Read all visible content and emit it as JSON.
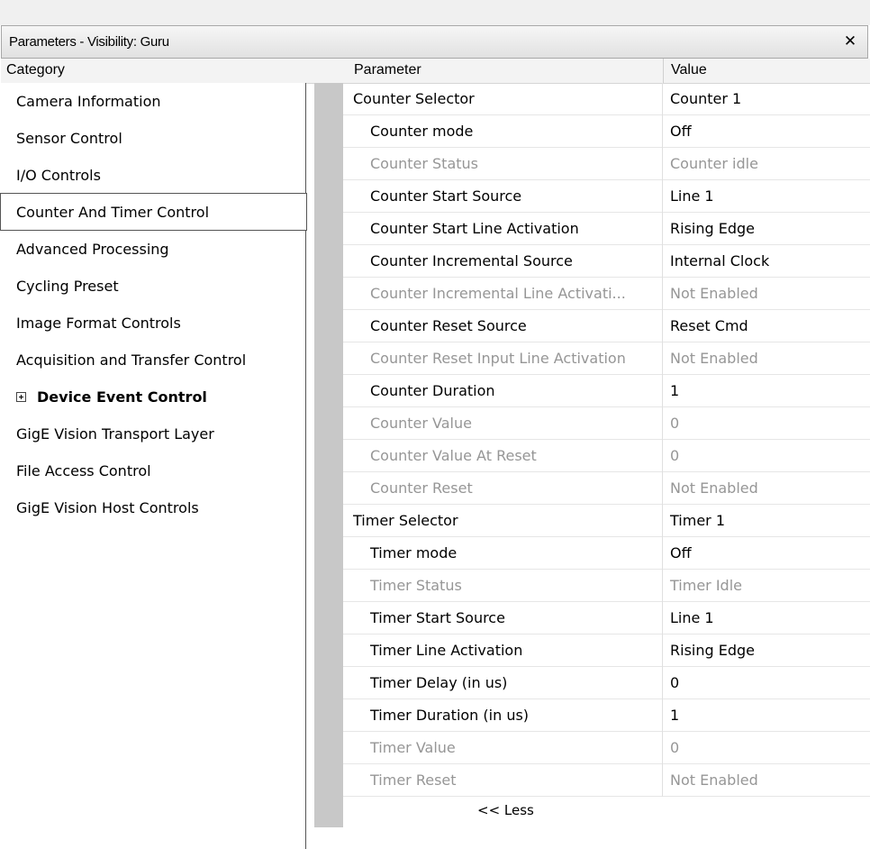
{
  "window": {
    "title": "Parameters - Visibility: Guru",
    "close_glyph": "✕"
  },
  "columns": {
    "category": "Category",
    "parameter": "Parameter",
    "value": "Value"
  },
  "categories": [
    {
      "label": "Camera Information"
    },
    {
      "label": "Sensor Control"
    },
    {
      "label": "I/O Controls"
    },
    {
      "label": "Counter And Timer Control",
      "selected": true
    },
    {
      "label": "Advanced Processing"
    },
    {
      "label": "Cycling Preset"
    },
    {
      "label": "Image Format Controls"
    },
    {
      "label": "Acquisition and Transfer Control"
    },
    {
      "label": "Device Event Control",
      "expandable": true,
      "bold": true
    },
    {
      "label": "GigE Vision Transport Layer"
    },
    {
      "label": "File Access Control"
    },
    {
      "label": "GigE Vision Host Controls"
    }
  ],
  "parameters": [
    {
      "name": "Counter Selector",
      "value": "Counter 1",
      "level": 0,
      "enabled": true
    },
    {
      "name": "Counter mode",
      "value": "Off",
      "level": 1,
      "enabled": true
    },
    {
      "name": "Counter Status",
      "value": "Counter idle",
      "level": 1,
      "enabled": false
    },
    {
      "name": "Counter Start Source",
      "value": "Line 1",
      "level": 1,
      "enabled": true
    },
    {
      "name": "Counter Start Line Activation",
      "value": "Rising Edge",
      "level": 1,
      "enabled": true
    },
    {
      "name": "Counter Incremental Source",
      "value": "Internal Clock",
      "level": 1,
      "enabled": true
    },
    {
      "name": "Counter Incremental Line Activati...",
      "value": "Not Enabled",
      "level": 1,
      "enabled": false
    },
    {
      "name": "Counter Reset Source",
      "value": "Reset Cmd",
      "level": 1,
      "enabled": true
    },
    {
      "name": "Counter Reset Input Line Activation",
      "value": "Not Enabled",
      "level": 1,
      "enabled": false
    },
    {
      "name": "Counter Duration",
      "value": "1",
      "level": 1,
      "enabled": true
    },
    {
      "name": "Counter Value",
      "value": "0",
      "level": 1,
      "enabled": false
    },
    {
      "name": "Counter Value At Reset",
      "value": "0",
      "level": 1,
      "enabled": false
    },
    {
      "name": "Counter Reset",
      "value": "Not Enabled",
      "level": 1,
      "enabled": false
    },
    {
      "name": "Timer Selector",
      "value": "Timer 1",
      "level": 0,
      "enabled": true
    },
    {
      "name": "Timer mode",
      "value": "Off",
      "level": 1,
      "enabled": true
    },
    {
      "name": "Timer Status",
      "value": "Timer Idle",
      "level": 1,
      "enabled": false
    },
    {
      "name": "Timer Start Source",
      "value": "Line 1",
      "level": 1,
      "enabled": true
    },
    {
      "name": "Timer Line Activation",
      "value": "Rising Edge",
      "level": 1,
      "enabled": true
    },
    {
      "name": "Timer Delay (in us)",
      "value": "0",
      "level": 1,
      "enabled": true
    },
    {
      "name": "Timer Duration (in us)",
      "value": "1",
      "level": 1,
      "enabled": true
    },
    {
      "name": "Timer Value",
      "value": "0",
      "level": 1,
      "enabled": false
    },
    {
      "name": "Timer Reset",
      "value": "Not Enabled",
      "level": 1,
      "enabled": false
    }
  ],
  "less_button": "<< Less",
  "colors": {
    "disabled_text": "#969696",
    "gutter": "#c8c8c8"
  }
}
